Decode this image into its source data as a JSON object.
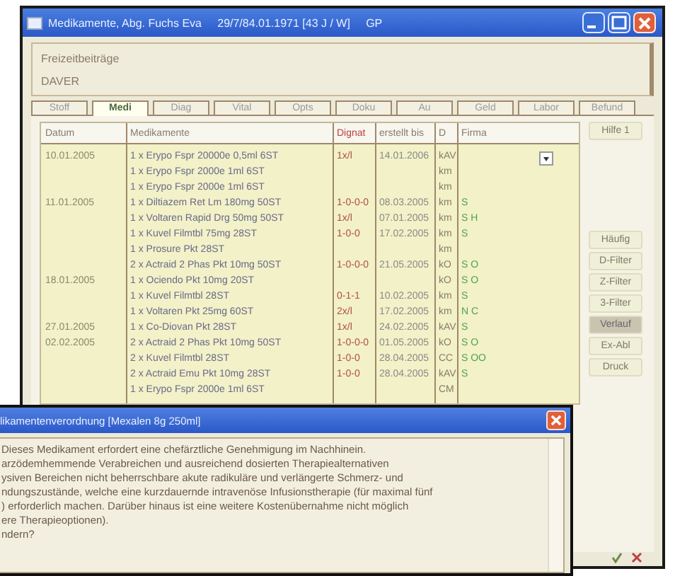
{
  "window": {
    "title": "Medikamente, Abg. Fuchs Eva     29/7/84.01.1971 [43 J / W]     GP"
  },
  "header": {
    "label": "Freizeitbeiträge",
    "value": "DAVER"
  },
  "tabs": [
    {
      "label": "Stoff",
      "selected": false
    },
    {
      "label": "Medi",
      "selected": true
    },
    {
      "label": "Diag",
      "selected": false
    },
    {
      "label": "Vital",
      "selected": false
    },
    {
      "label": "Opts",
      "selected": false
    },
    {
      "label": "Doku",
      "selected": false
    },
    {
      "label": "Au",
      "selected": false
    },
    {
      "label": "Geld",
      "selected": false
    },
    {
      "label": "Labor",
      "selected": false
    },
    {
      "label": "Befund",
      "selected": false
    }
  ],
  "table": {
    "columns": [
      "Datum",
      "Medikamente",
      "Dignat",
      "erstellt bis",
      "D",
      "Firma"
    ],
    "rows": [
      [
        "10.01.2005",
        "1 x Erypo Fspr 20000e 0,5ml 6ST",
        "1x/l",
        "14.01.2006",
        "kAV",
        ""
      ],
      [
        "",
        "1 x Erypo Fspr 2000e 1ml 6ST",
        "",
        "",
        "km",
        ""
      ],
      [
        "",
        "1 x Erypo Fspr 2000e 1ml 6ST",
        "",
        "",
        "km",
        ""
      ],
      [
        "11.01.2005",
        "1 x Diltiazem Ret Lm 180mg 50ST",
        "1-0-0-0",
        "08.03.2005",
        "km",
        "S"
      ],
      [
        "",
        "1 x Voltaren Rapid Drg 50mg 50ST",
        "1x/l",
        "07.01.2005",
        "km",
        "S H"
      ],
      [
        "",
        "1 x Kuvel Filmtbl 75mg 28ST",
        "1-0-0",
        "17.02.2005",
        "km",
        "S"
      ],
      [
        "",
        "1 x Prosure Pkt 28ST",
        "",
        "",
        "km",
        ""
      ],
      [
        "",
        "2 x Actraid 2 Phas Pkt 10mg 50ST",
        "1-0-0-0",
        "21.05.2005",
        "kO",
        "S O"
      ],
      [
        "18.01.2005",
        "1 x Ociendo Pkt 10mg 20ST",
        "",
        "",
        "kO",
        "S O"
      ],
      [
        "",
        "1 x Kuvel Filmtbl 28ST",
        "0-1-1",
        "10.02.2005",
        "km",
        "S"
      ],
      [
        "",
        "1 x Voltaren Pkt 25mg 60ST",
        "2x/l",
        "17.02.2005",
        "km",
        "N C"
      ],
      [
        "27.01.2005",
        "1 x Co-Diovan Pkt 28ST",
        "1x/l",
        "24.02.2005",
        "kAV",
        "S"
      ],
      [
        "02.02.2005",
        "2 x Actraid 2 Phas Pkt 10mg 50ST",
        "1-0-0-0",
        "01.05.2005",
        "kO",
        "S O"
      ],
      [
        "",
        "2 x Kuvel Filmtbl 28ST",
        "1-0-0",
        "28.04.2005",
        "CC",
        "S OO"
      ],
      [
        "",
        "2 x Actraid Emu Pkt 10mg 28ST",
        "1-0-0",
        "28.04.2005",
        "kAV",
        "S"
      ],
      [
        "",
        "1 x Erypo Fspr 2000e 1ml 6ST",
        "",
        "",
        "CM",
        ""
      ]
    ]
  },
  "side_buttons": [
    {
      "label": "Hilfe 1",
      "pressed": false
    },
    {
      "label": "Häufig",
      "pressed": false
    },
    {
      "label": "D-Filter",
      "pressed": false
    },
    {
      "label": "Z-Filter",
      "pressed": false
    },
    {
      "label": "3-Filter",
      "pressed": false
    },
    {
      "label": "Verlauf",
      "pressed": true
    },
    {
      "label": "Ex-Abl",
      "pressed": false
    },
    {
      "label": "Druck",
      "pressed": false
    }
  ],
  "dialog": {
    "title": "likamentenverordnung [Mexalen 8g 250ml]",
    "lines": [
      "Dieses Medikament erfordert eine chefärztliche Genehmigung im Nachhinein.",
      "arzödemhemmende Verabreichen und ausreichend dosierten Therapiealternativen",
      "ysiven Bereichen nicht beherrschbare akute radikuläre und verlängerte Schmerz- und",
      "ndungszustände, welche eine kurzdauernde intravenöse Infusionstherapie (für maximal fünf",
      ") erforderlich machen. Darüber hinaus ist eine weitere Kostenübernahme nicht möglich",
      "ere Therapieoptionen).",
      "ndern?"
    ]
  }
}
